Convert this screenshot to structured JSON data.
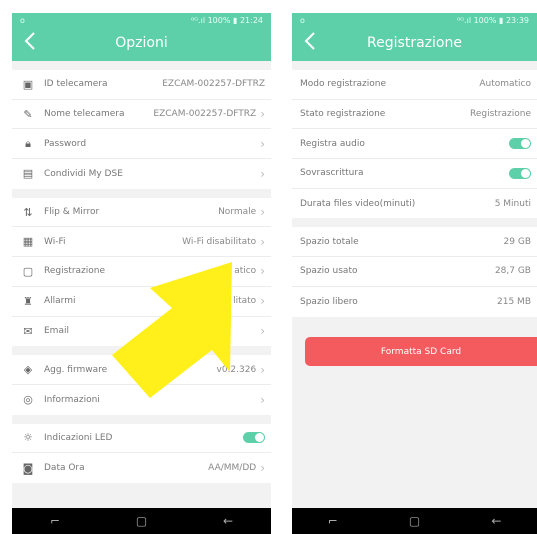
{
  "left": {
    "status": {
      "left": "o",
      "right": "⁰ᴳ.ıl 100% ▮ 21:24"
    },
    "title": "Opzioni",
    "groups": [
      [
        {
          "icon": "camera-id-icon",
          "glyph": "▣",
          "label": "ID telecamera",
          "value": "EZCAM-002257-DFTRZ",
          "chev": ""
        },
        {
          "icon": "edit-icon",
          "glyph": "✎",
          "label": "Nome telecamera",
          "value": "EZCAM-002257-DFTRZ",
          "chev": "›"
        },
        {
          "icon": "lock-icon",
          "glyph": "🔒︎",
          "label": "Password",
          "value": "",
          "chev": "›"
        },
        {
          "icon": "share-icon",
          "glyph": "▤",
          "label": "Condividi My DSE",
          "value": "",
          "chev": "›"
        }
      ],
      [
        {
          "icon": "flip-icon",
          "glyph": "⇅",
          "label": "Flip & Mirror",
          "value": "Normale",
          "chev": "›"
        },
        {
          "icon": "wifi-icon",
          "glyph": "▦",
          "label": "Wi-Fi",
          "value": "Wi-Fi disabilitato",
          "chev": "›"
        },
        {
          "icon": "record-icon",
          "glyph": "▢",
          "label": "Registrazione",
          "value": "atico",
          "chev": "›"
        },
        {
          "icon": "alarm-icon",
          "glyph": "♜",
          "label": "Allarmi",
          "value": "litato",
          "chev": "›"
        },
        {
          "icon": "email-icon",
          "glyph": "✉",
          "label": "Email",
          "value": "",
          "chev": "›"
        }
      ],
      [
        {
          "icon": "firmware-icon",
          "glyph": "◈",
          "label": "Agg. firmware",
          "value": "v0.2.326",
          "chev": "›"
        },
        {
          "icon": "info-icon",
          "glyph": "◎",
          "label": "Informazioni",
          "value": "",
          "chev": "›"
        }
      ],
      [
        {
          "icon": "led-icon",
          "glyph": "☼",
          "label": "Indicazioni LED",
          "value": "",
          "chev": "",
          "toggle": true
        },
        {
          "icon": "clock-icon",
          "glyph": "◙",
          "label": "Data Ora",
          "value": "AA/MM/DD",
          "chev": "›"
        }
      ]
    ]
  },
  "right": {
    "status": {
      "left": "o",
      "right": "⁰ᴳ.ıl 100% ▮ 23:39"
    },
    "title": "Registrazione",
    "groups": [
      [
        {
          "label": "Modo registrazione",
          "value": "Automatico"
        },
        {
          "label": "Stato registrazione",
          "value": "Registrazione"
        },
        {
          "label": "Registra audio",
          "value": "",
          "toggle": true
        },
        {
          "label": "Sovrascrittura",
          "value": "",
          "toggle": true
        },
        {
          "label": "Durata files video(minuti)",
          "value": "5 Minuti"
        }
      ],
      [
        {
          "label": "Spazio totale",
          "value": "29 GB"
        },
        {
          "label": "Spazio usato",
          "value": "28,7 GB"
        },
        {
          "label": "Spazio libero",
          "value": "215 MB"
        }
      ]
    ],
    "format_button": "Formatta SD Card"
  },
  "nav": {
    "back": "⌐",
    "home": "▢",
    "recent": "←"
  },
  "colors": {
    "accent": "#5dd0a9",
    "danger": "#f35b5f",
    "arrow": "#ffef1a"
  }
}
